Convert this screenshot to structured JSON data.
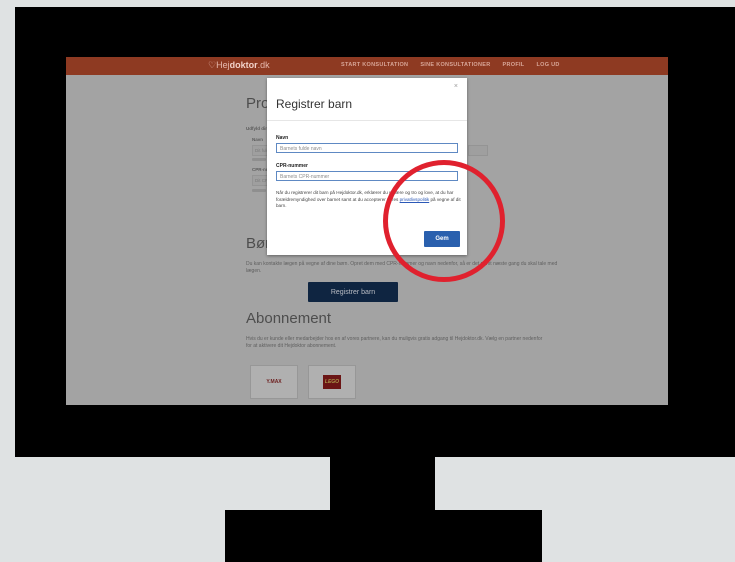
{
  "brand": {
    "name_light": "Hej",
    "name_bold": "doktor",
    "tld": ".dk"
  },
  "nav": [
    "START KONSULTATION",
    "SINE KONSULTATIONER",
    "PROFIL",
    "LOG UD"
  ],
  "profile": {
    "heading": "Profil",
    "intro": "Udfyld dine...",
    "name_label": "Navn",
    "name_placeholder": "Dit fulde",
    "cpr_label": "CPR-num",
    "cpr_placeholder": "Dit CPR"
  },
  "children": {
    "heading": "Børn",
    "text": "Du kan kontakte lægen på vegne af dine børn. Opret dem med CPR-nummer og navn nedenfor, så er det nemt næste gang du skal tale med lægen.",
    "button": "Registrer barn"
  },
  "subscription": {
    "heading": "Abonnement",
    "text": "Hvis du er kunde eller medarbejder hos en af vores partnere, kan du muligvis gratis adgang til Hejdoktor.dk. Vælg en partner nedenfor for at aktivere dit Hejdoktor abonnement.",
    "partner1": "Y.MAX",
    "partner2": "LEGO"
  },
  "modal": {
    "close": "×",
    "title": "Registrer barn",
    "name_label": "Navn",
    "name_placeholder": "Barnets fulde navn",
    "cpr_label": "CPR-nummer",
    "cpr_placeholder": "Barnets CPR-nummer",
    "consent_pre": "Når du registrerer dit barn på Hejdoktor.dk, erklærer du på ære og tro og love, at du har forældremyndighed over barnet samt at du accepterer vores ",
    "consent_link": "privatlivspolitik",
    "consent_post": " på vegne af dit barn.",
    "save_button": "Gem"
  },
  "colors": {
    "highlight": "#e0212e",
    "primary": "#2a60ae",
    "brand": "#c8502c"
  }
}
